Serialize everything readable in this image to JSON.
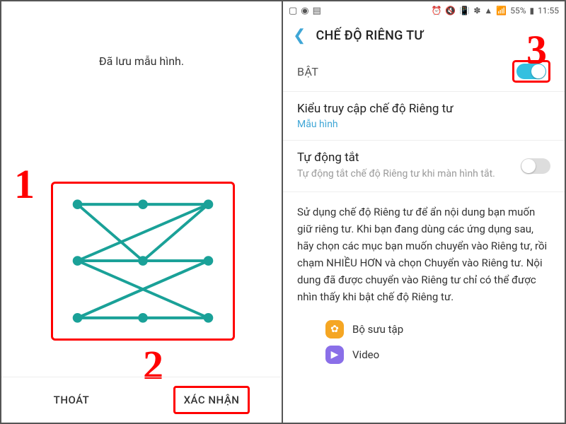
{
  "left": {
    "saved_message": "Đã lưu mẫu hình.",
    "exit_label": "THOÁT",
    "confirm_label": "XÁC NHẬN",
    "annotation1": "1",
    "annotation2": "2"
  },
  "right": {
    "status": {
      "battery_pct": "55%",
      "time": "11:55"
    },
    "header_title": "CHẾ ĐỘ RIÊNG TƯ",
    "annotation3": "3",
    "on_label": "BẬT",
    "access_type": {
      "title": "Kiểu truy cập chế độ Riêng tư",
      "value": "Mẫu hình"
    },
    "auto_off": {
      "title": "Tự động tắt",
      "subtitle": "Tự động tắt chế độ Riêng tư khi màn hình tắt."
    },
    "description": "Sử dụng chế độ Riêng tư để ẩn nội dung bạn muốn giữ riêng tư. Khi bạn đang dùng các ứng dụng sau, hãy chọn các mục bạn muốn chuyển vào Riêng tư, rồi chạm NHIỀU HƠN và chọn Chuyển vào Riêng tư. Nội dung đã được chuyển vào Riêng tư chỉ có thể được nhìn thấy khi bật chế độ Riêng tư.",
    "apps": {
      "gallery": "Bộ sưu tập",
      "video": "Video"
    }
  }
}
